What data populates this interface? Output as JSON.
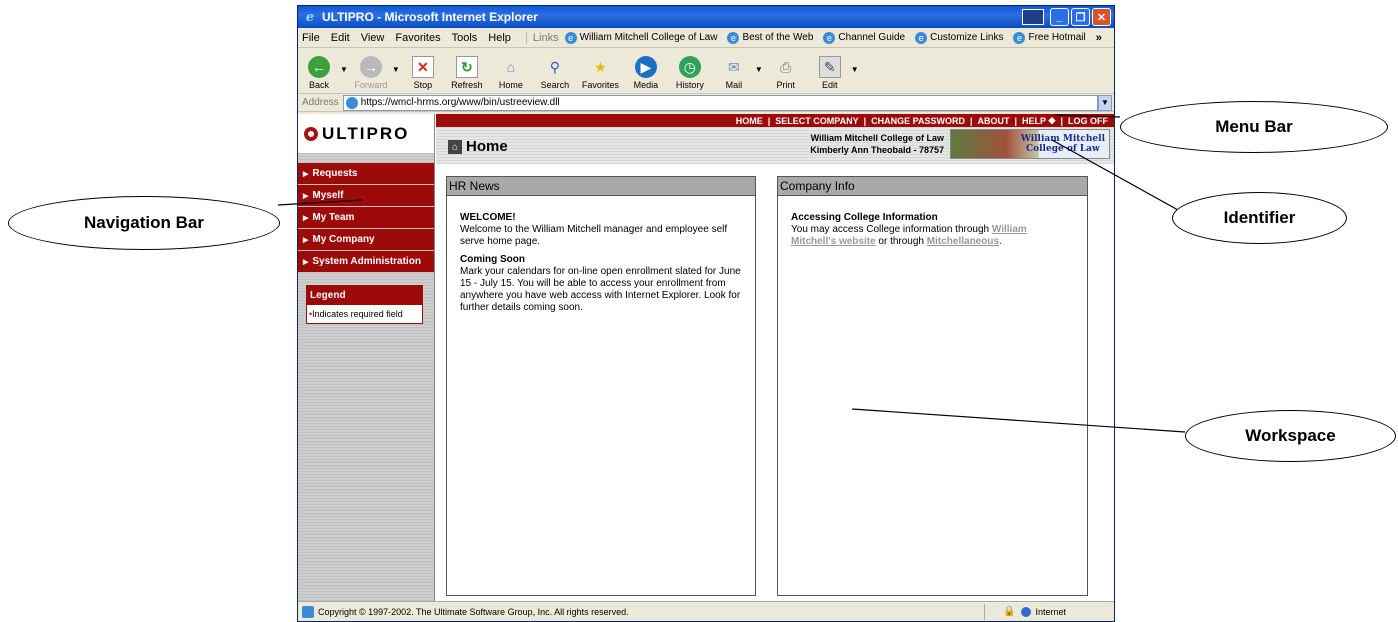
{
  "window": {
    "title": "ULTIPRO - Microsoft Internet Explorer"
  },
  "menu": [
    "File",
    "Edit",
    "View",
    "Favorites",
    "Tools",
    "Help"
  ],
  "links": {
    "label": "Links",
    "items": [
      "William Mitchell College of Law",
      "Best of the Web",
      "Channel Guide",
      "Customize Links",
      "Free Hotmail"
    ]
  },
  "toolbar": {
    "back": "Back",
    "forward": "Forward",
    "stop": "Stop",
    "refresh": "Refresh",
    "home": "Home",
    "search": "Search",
    "favorites": "Favorites",
    "media": "Media",
    "history": "History",
    "mail": "Mail",
    "print": "Print",
    "edit": "Edit"
  },
  "address": {
    "label": "Address",
    "url": "https://wmcl-hrms.org/www/bin/ustreeview.dll"
  },
  "app": {
    "logo": "ULTIPRO",
    "topnav": [
      "HOME",
      "SELECT COMPANY",
      "CHANGE PASSWORD",
      "ABOUT",
      "HELP",
      "LOG OFF"
    ],
    "page_title": "Home",
    "identifier": {
      "company": "William Mitchell College of Law",
      "user": "Kimberly Ann Theobald - 78757"
    },
    "banner": {
      "line1": "William Mitchell",
      "line2": "College of Law"
    },
    "nav": [
      "Requests",
      "Myself",
      "My Team",
      "My Company",
      "System Administration"
    ],
    "legend": {
      "title": "Legend",
      "text": "Indicates required field"
    },
    "hr_news": {
      "title": "HR News",
      "welcome_title": "WELCOME!",
      "welcome_text": "Welcome to the William Mitchell manager and employee self serve home page.",
      "soon_title": "Coming Soon",
      "soon_text": "Mark your calendars for on-line open enrollment slated for June 15 - July 15. You will be able to access your enrollment from anywhere you have web access with Internet Explorer. Look for further details coming soon."
    },
    "company_info": {
      "title": "Company Info",
      "section_title": "Accessing College Information",
      "text_before": "You may access College information through ",
      "link1": "William Mitchell's website",
      "text_mid": " or through ",
      "link2": "Mitchellaneous",
      "text_after": "."
    }
  },
  "status": {
    "copyright": "Copyright © 1997-2002. The Ultimate Software Group, Inc. All rights reserved.",
    "zone": "Internet"
  },
  "callouts": {
    "menu_bar": "Menu Bar",
    "navigation_bar": "Navigation Bar",
    "identifier": "Identifier",
    "workspace": "Workspace"
  }
}
